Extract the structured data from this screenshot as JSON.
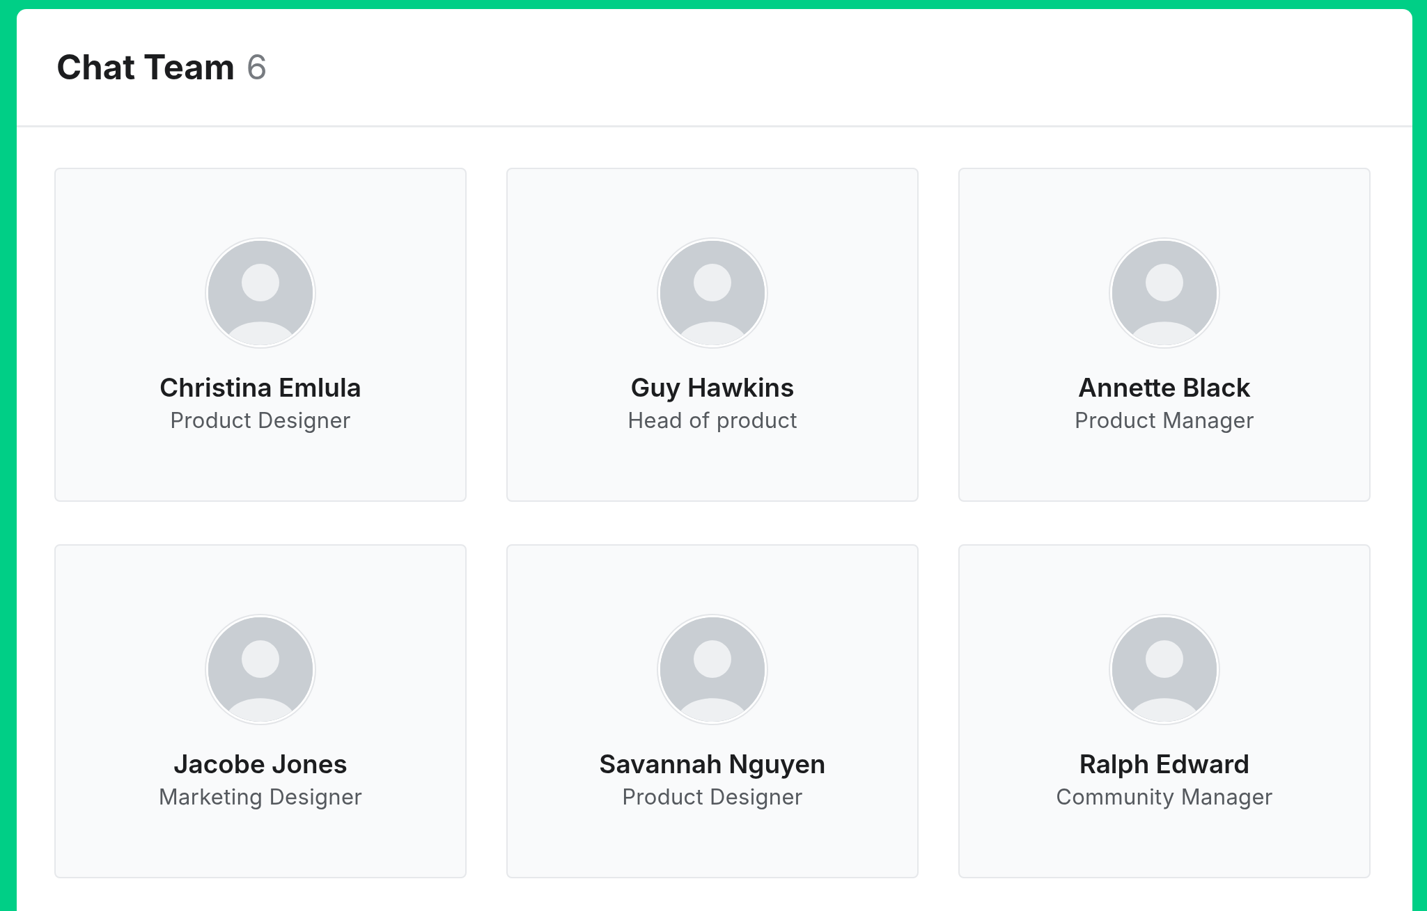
{
  "header": {
    "title": "Chat Team",
    "count": "6"
  },
  "members": [
    {
      "name": "Christina Emlula",
      "role": "Product Designer"
    },
    {
      "name": "Guy Hawkins",
      "role": "Head of product"
    },
    {
      "name": "Annette Black",
      "role": "Product Manager"
    },
    {
      "name": "Jacobe Jones",
      "role": "Marketing Designer"
    },
    {
      "name": "Savannah Nguyen",
      "role": "Product Designer"
    },
    {
      "name": "Ralph Edward",
      "role": "Community Manager"
    }
  ]
}
